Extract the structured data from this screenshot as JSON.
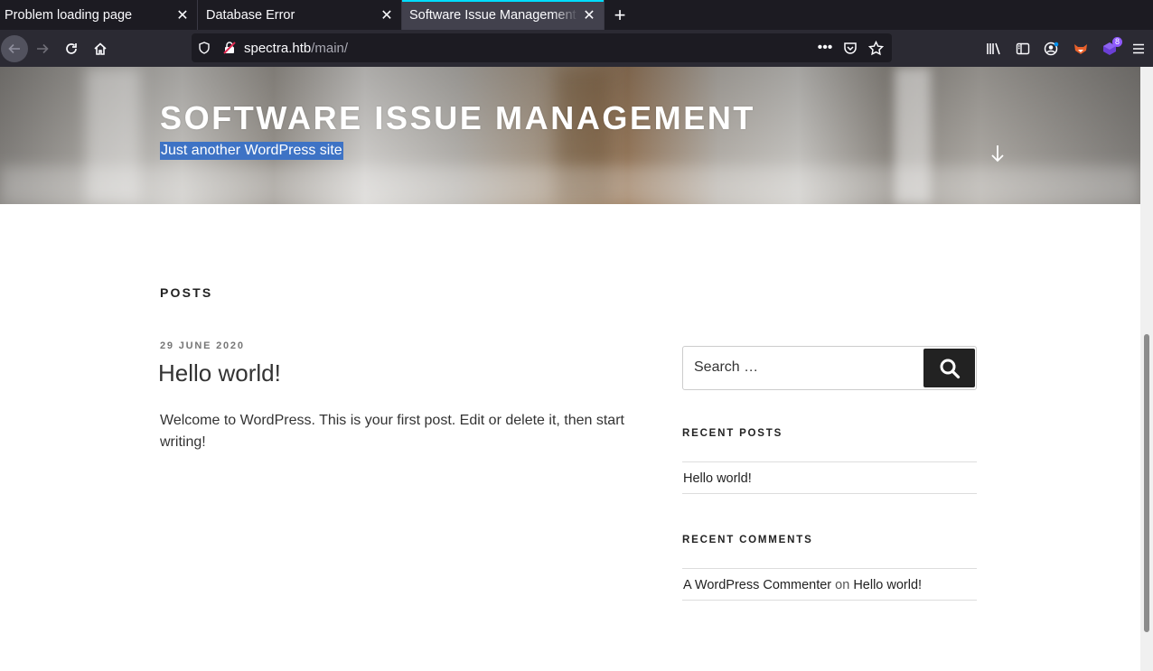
{
  "browser": {
    "tabs": [
      {
        "label": "Problem loading page",
        "active": false
      },
      {
        "label": "Database Error",
        "active": false
      },
      {
        "label": "Software Issue Management",
        "active": true
      }
    ],
    "url": {
      "host": "spectra.htb",
      "path": "/main/"
    },
    "extension_badge": "8",
    "colors": {
      "tabbar": "#1c1b22",
      "navbar": "#2b2a33",
      "active_tab": "#42414d",
      "accent": "#00ddff"
    }
  },
  "site": {
    "title": "Software Issue Management",
    "description": "Just another WordPress site"
  },
  "main": {
    "section_title": "Posts",
    "post": {
      "date": "29 June 2020",
      "title": "Hello world!",
      "excerpt": "Welcome to WordPress. This is your first post. Edit or delete it, then start writing!"
    }
  },
  "sidebar": {
    "search": {
      "placeholder": "Search …"
    },
    "recent_posts": {
      "title": "Recent Posts",
      "items": [
        "Hello world!"
      ]
    },
    "recent_comments": {
      "title": "Recent Comments",
      "items": [
        {
          "author": "A WordPress Commenter",
          "connector": "on",
          "post": "Hello world!"
        }
      ]
    }
  }
}
